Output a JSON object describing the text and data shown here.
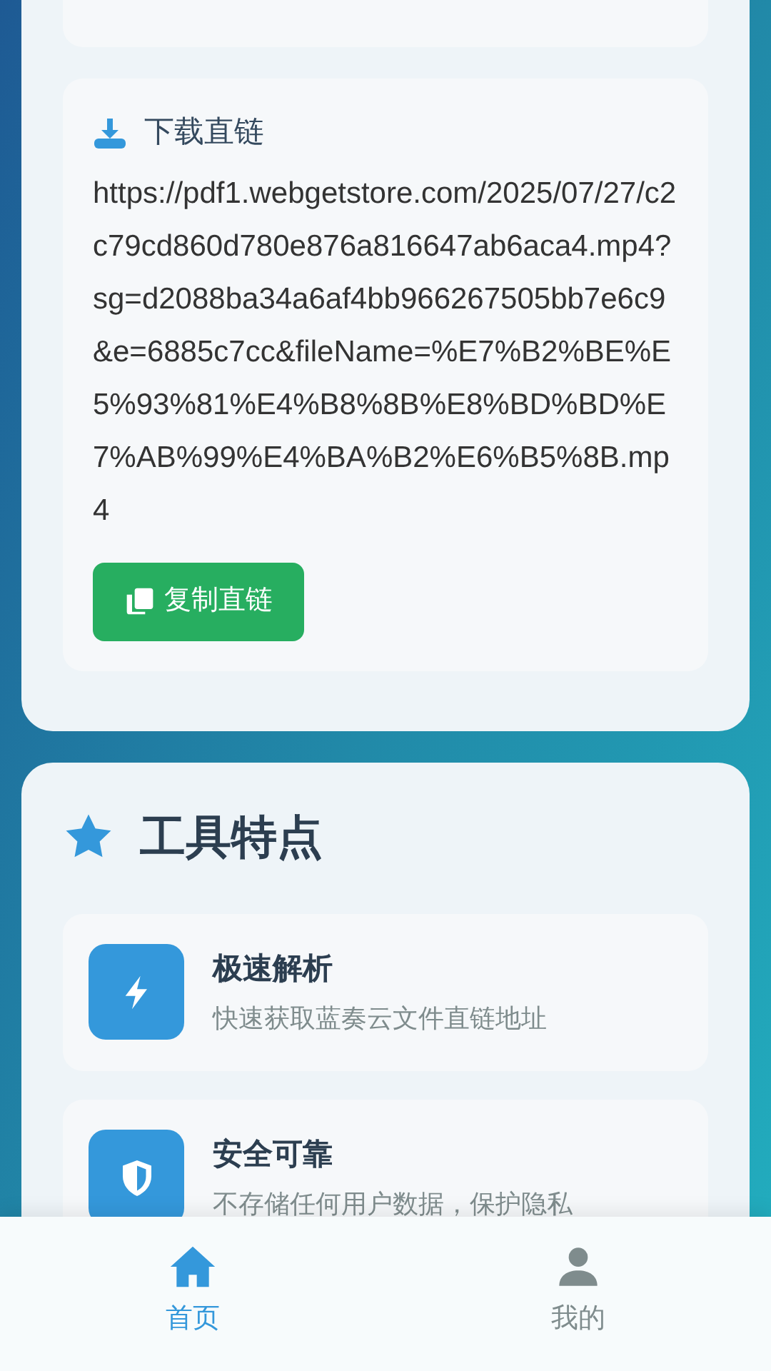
{
  "download": {
    "title": "下载直链",
    "url": "https://pdf1.webgetstore.com/2025/07/27/c2c79cd860d780e876a816647ab6aca4.mp4?sg=d2088ba34a6af4bb966267505bb7e6c9&e=6885c7cc&fileName=%E7%B2%BE%E5%93%81%E4%B8%8B%E8%BD%BD%E7%AB%99%E4%BA%B2%E6%B5%8B.mp4",
    "copy_button": "复制直链"
  },
  "features": {
    "title": "工具特点",
    "items": [
      {
        "kind": "speed",
        "title": "极速解析",
        "description": "快速获取蓝奏云文件直链地址"
      },
      {
        "kind": "secure",
        "title": "安全可靠",
        "description": "不存储任何用户数据，保护隐私"
      }
    ]
  },
  "bottom_nav": [
    {
      "kind": "home",
      "label": "首页",
      "selected": true
    },
    {
      "kind": "profile",
      "label": "我的",
      "selected": false
    }
  ]
}
